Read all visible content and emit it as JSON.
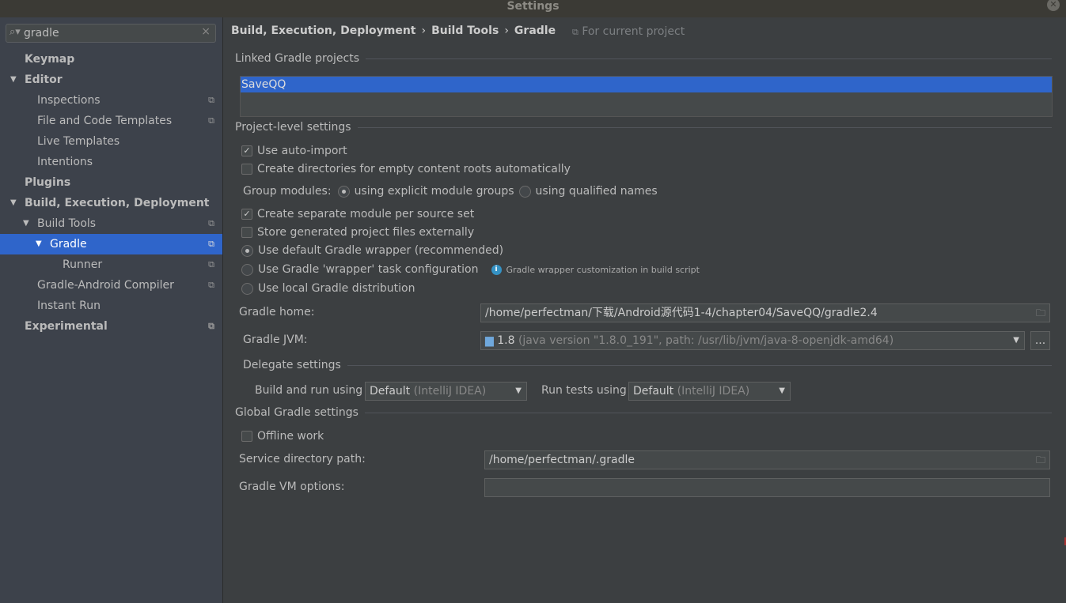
{
  "window": {
    "title": "Settings"
  },
  "sidebar": {
    "search": {
      "value": "gradle"
    },
    "items": [
      {
        "label": "Keymap"
      },
      {
        "label": "Editor"
      },
      {
        "label": "Inspections"
      },
      {
        "label": "File and Code Templates"
      },
      {
        "label": "Live Templates"
      },
      {
        "label": "Intentions"
      },
      {
        "label": "Plugins"
      },
      {
        "label": "Build, Execution, Deployment"
      },
      {
        "label": "Build Tools"
      },
      {
        "label": "Gradle"
      },
      {
        "label": "Runner"
      },
      {
        "label": "Gradle-Android Compiler"
      },
      {
        "label": "Instant Run"
      },
      {
        "label": "Experimental"
      }
    ]
  },
  "main": {
    "breadcrumb": [
      "Build, Execution, Deployment",
      "Build Tools",
      "Gradle"
    ],
    "breadcrumb_sep": "›",
    "for_current_project": "For current project",
    "linked_title": "Linked Gradle projects",
    "linked_projects": [
      "SaveQQ"
    ],
    "project_level_title": "Project-level settings",
    "use_auto_import": "Use auto-import",
    "create_dirs": "Create directories for empty content roots automatically",
    "group_modules": "Group modules:",
    "group_explicit": "using explicit module groups",
    "group_qualified": "using qualified names",
    "separate_module": "Create separate module per source set",
    "store_external": "Store generated project files externally",
    "default_wrapper": "Use default Gradle wrapper (recommended)",
    "wrapper_task": "Use Gradle 'wrapper' task configuration",
    "wrapper_hint": "Gradle wrapper customization in build script",
    "local_dist": "Use local Gradle distribution",
    "gradle_home_label": "Gradle home:",
    "gradle_home": "/home/perfectman/下载/Android源代码1-4/chapter04/SaveQQ/gradle2.4",
    "jvm_label": "Gradle JVM:",
    "jvm_version": "1.8",
    "jvm_detail": "(java version \"1.8.0_191\", path: /usr/lib/jvm/java-8-openjdk-amd64)",
    "jvm_more": "...",
    "delegate_title": "Delegate settings",
    "build_run_label": "Build and run using",
    "build_run_value": "Default",
    "build_run_detail": "(IntelliJ IDEA)",
    "tests_label": "Run tests using",
    "tests_value": "Default",
    "tests_detail": "(IntelliJ IDEA)",
    "global_title": "Global Gradle settings",
    "offline": "Offline work",
    "service_dir_label": "Service directory path:",
    "service_dir": "/home/perfectman/.gradle",
    "vm_options_label": "Gradle VM options:",
    "vm_options": ""
  }
}
